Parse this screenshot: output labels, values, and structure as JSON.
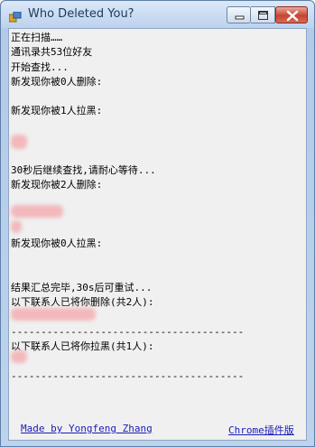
{
  "window": {
    "title": "Who Deleted You?"
  },
  "log_lines": [
    "正在扫描……",
    "通讯录共53位好友",
    "开始查找...",
    "新发现你被0人删除:",
    "",
    "新发现你被1人拉黑:",
    "",
    "",
    "",
    "30秒后继续查找,请耐心等待...",
    "新发现你被2人删除:",
    "",
    "",
    "",
    "新发现你被0人拉黑:",
    "",
    "",
    "结果汇总完毕,30s后可重试...",
    "以下联系人已将你删除(共2人):",
    "",
    "---------------------------------------",
    "以下联系人已将你拉黑(共1人):",
    "",
    "---------------------------------------"
  ],
  "footer": {
    "author_link": "Made by Yongfeng Zhang",
    "plugin_link": "Chrome插件版"
  },
  "colors": {
    "redacted_blur": "#f2b8bc"
  }
}
